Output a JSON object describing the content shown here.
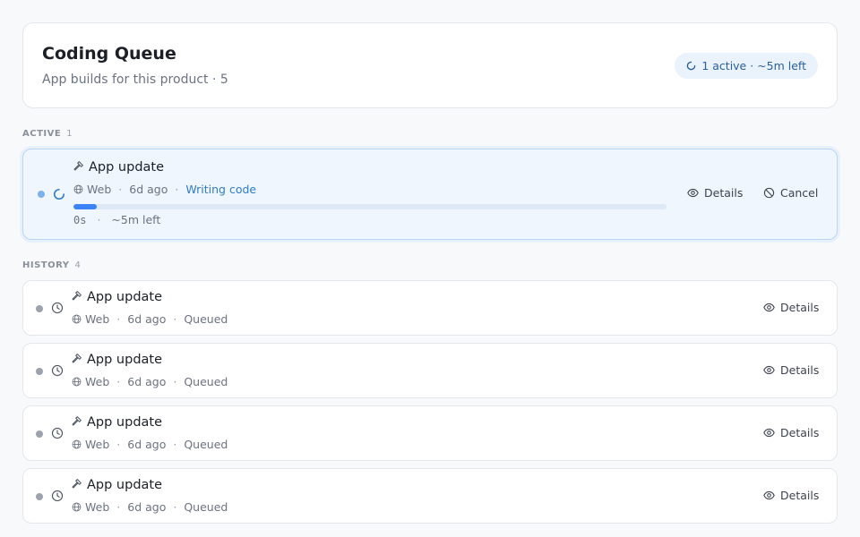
{
  "header": {
    "title": "Coding Queue",
    "subtitle": "App builds for this product · 5",
    "status_pill": "1 active · ~5m left"
  },
  "sections": {
    "active": {
      "label": "ACTIVE",
      "count": "1"
    },
    "history": {
      "label": "HISTORY",
      "count": "4"
    }
  },
  "active_job": {
    "title": "App update",
    "platform": "Web",
    "age": "6d ago",
    "status": "Writing code",
    "elapsed": "0s",
    "remaining": "~5m left",
    "progress_fraction": 0.04,
    "details_label": "Details",
    "cancel_label": "Cancel"
  },
  "history_jobs": [
    {
      "title": "App update",
      "platform": "Web",
      "age": "6d ago",
      "status": "Queued",
      "details_label": "Details"
    },
    {
      "title": "App update",
      "platform": "Web",
      "age": "6d ago",
      "status": "Queued",
      "details_label": "Details"
    },
    {
      "title": "App update",
      "platform": "Web",
      "age": "6d ago",
      "status": "Queued",
      "details_label": "Details"
    },
    {
      "title": "App update",
      "platform": "Web",
      "age": "6d ago",
      "status": "Queued",
      "details_label": "Details"
    }
  ],
  "colors": {
    "accent": "#3b82f6",
    "active_bg": "#eff6fd",
    "active_border": "#b8d6f3",
    "status_link": "#2f7cc6",
    "queued_dot": "#9ca3af"
  },
  "icons": {
    "status": "spinner-icon",
    "job": "hammer-icon",
    "platform": "globe-icon",
    "details": "eye-icon",
    "cancel": "ban-icon",
    "queued": "clock-icon"
  }
}
